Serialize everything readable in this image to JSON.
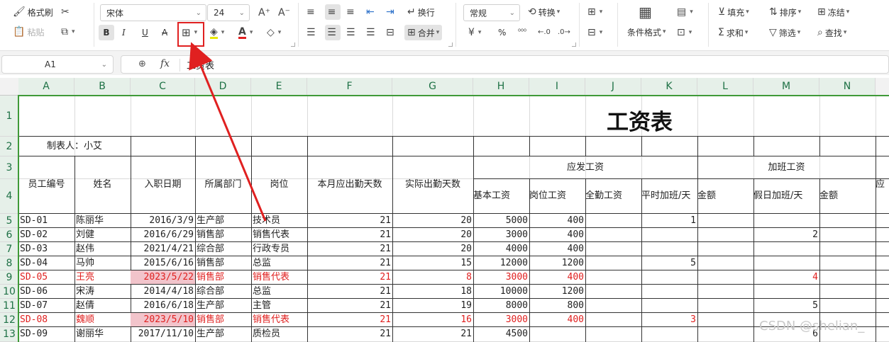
{
  "ribbon": {
    "format_painter": "格式刷",
    "paste": "粘贴",
    "font_name": "宋体",
    "font_size": "24",
    "wrap": "换行",
    "number_format": "常规",
    "convert": "转换",
    "merge": "合并",
    "cond_format": "条件格式",
    "fill": "填充",
    "sort": "排序",
    "freeze": "冻结",
    "sum": "求和",
    "filter": "筛选",
    "find": "查找",
    "percent": "%",
    "bold": "B",
    "italic": "I",
    "underline": "U",
    "strike": "A",
    "font_color": "A"
  },
  "formula_bar": {
    "name_box": "A1",
    "fx": "fx",
    "content": "工资表"
  },
  "columns": [
    "A",
    "B",
    "C",
    "D",
    "E",
    "F",
    "G",
    "H",
    "I",
    "J",
    "K",
    "L",
    "M",
    "N"
  ],
  "rows": [
    "1",
    "2",
    "3",
    "4",
    "5",
    "6",
    "7",
    "8",
    "9",
    "10",
    "11",
    "12",
    "13"
  ],
  "sheet": {
    "title": "工资表",
    "maker": "制表人：小艾",
    "headers": {
      "emp_no": "员工编号",
      "name": "姓名",
      "hire_date": "入职日期",
      "dept": "所属部门",
      "position": "岗位",
      "due_days": "本月应出勤天数",
      "actual_days": "实际出勤天数",
      "payable": "应发工资",
      "overtime": "加班工资",
      "base": "基本工资",
      "post": "岗位工资",
      "attendance": "全勤工资",
      "weekday_ot": "平时加班/天",
      "amount1": "金额",
      "holiday_ot": "假日加班/天",
      "amount2": "金额",
      "cut": "应"
    },
    "data": [
      {
        "id": "SD-01",
        "name": "陈丽华",
        "date": "2016/3/9",
        "dept": "生产部",
        "pos": "技术员",
        "due": "21",
        "act": "20",
        "base": "5000",
        "post": "400",
        "att": "",
        "wot": "1",
        "amt1": "",
        "hot": "",
        "hl": false
      },
      {
        "id": "SD-02",
        "name": "刘健",
        "date": "2016/6/29",
        "dept": "销售部",
        "pos": "销售代表",
        "due": "21",
        "act": "20",
        "base": "3000",
        "post": "400",
        "att": "",
        "wot": "",
        "amt1": "",
        "hot": "2",
        "hl": false
      },
      {
        "id": "SD-03",
        "name": "赵伟",
        "date": "2021/4/21",
        "dept": "综合部",
        "pos": "行政专员",
        "due": "21",
        "act": "20",
        "base": "4000",
        "post": "400",
        "att": "",
        "wot": "",
        "amt1": "",
        "hot": "",
        "hl": false
      },
      {
        "id": "SD-04",
        "name": "马帅",
        "date": "2015/6/16",
        "dept": "销售部",
        "pos": "总监",
        "due": "21",
        "act": "15",
        "base": "12000",
        "post": "1200",
        "att": "",
        "wot": "5",
        "amt1": "",
        "hot": "",
        "hl": false
      },
      {
        "id": "SD-05",
        "name": "王亮",
        "date": "2023/5/22",
        "dept": "销售部",
        "pos": "销售代表",
        "due": "21",
        "act": "8",
        "base": "3000",
        "post": "400",
        "att": "",
        "wot": "",
        "amt1": "",
        "hot": "4",
        "hl": true
      },
      {
        "id": "SD-06",
        "name": "宋涛",
        "date": "2014/4/18",
        "dept": "综合部",
        "pos": "总监",
        "due": "21",
        "act": "18",
        "base": "10000",
        "post": "1200",
        "att": "",
        "wot": "",
        "amt1": "",
        "hot": "",
        "hl": false
      },
      {
        "id": "SD-07",
        "name": "赵倩",
        "date": "2016/6/18",
        "dept": "生产部",
        "pos": "主管",
        "due": "21",
        "act": "19",
        "base": "8000",
        "post": "800",
        "att": "",
        "wot": "",
        "amt1": "",
        "hot": "5",
        "hl": false
      },
      {
        "id": "SD-08",
        "name": "魏顺",
        "date": "2023/5/10",
        "dept": "销售部",
        "pos": "销售代表",
        "due": "21",
        "act": "16",
        "base": "3000",
        "post": "400",
        "att": "",
        "wot": "3",
        "amt1": "",
        "hot": "",
        "hl": true
      },
      {
        "id": "SD-09",
        "name": "谢丽华",
        "date": "2017/11/10",
        "dept": "生产部",
        "pos": "质检员",
        "due": "21",
        "act": "21",
        "base": "4500",
        "post": "",
        "att": "",
        "wot": "",
        "amt1": "",
        "hot": "6",
        "hl": false
      }
    ]
  },
  "watermark": "CSDN @shelian_",
  "colors": {
    "accent_green": "#3f9a38",
    "highlight_red": "#e0201f",
    "highlight_pink": "#f2c4cb",
    "annotation_red": "#e02020"
  }
}
